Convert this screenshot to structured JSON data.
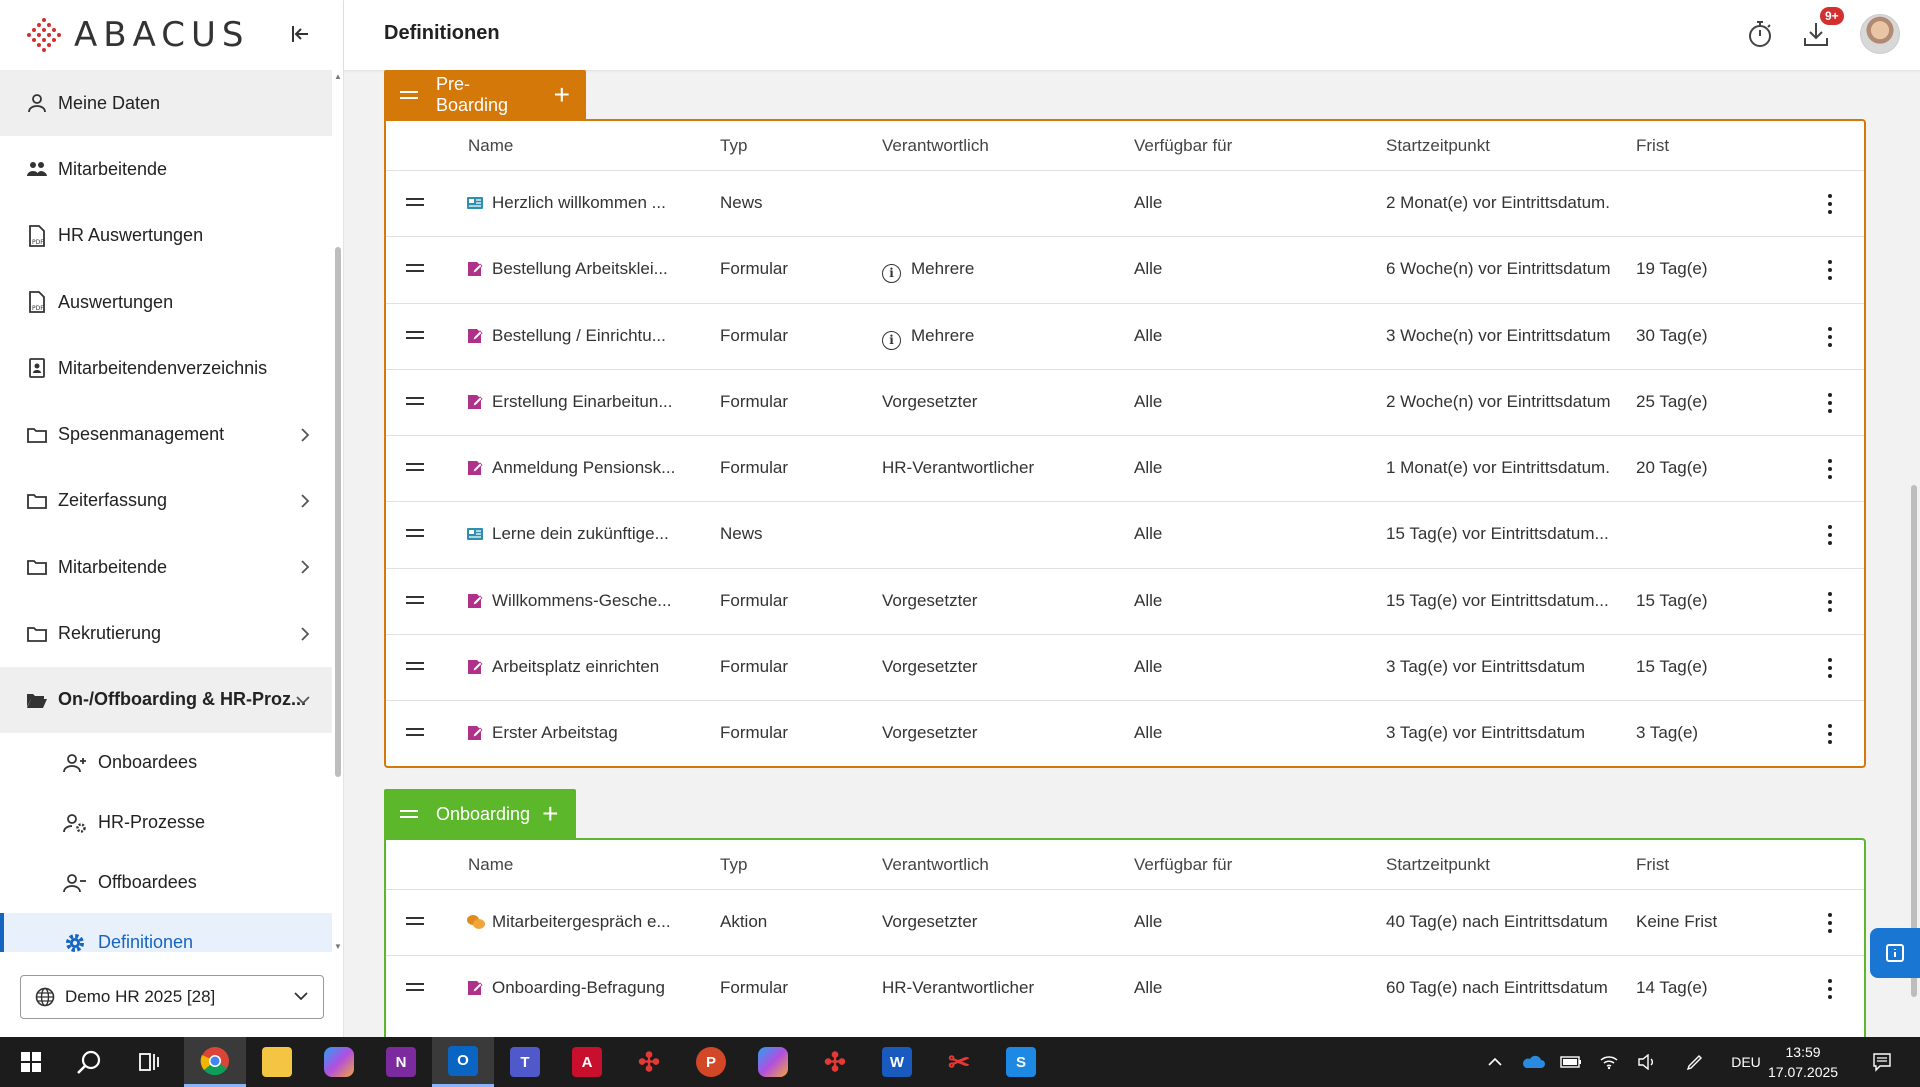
{
  "app": {
    "logo_text": "ABACUS"
  },
  "header": {
    "title": "Definitionen",
    "badge": "9+"
  },
  "sidebar": {
    "items": [
      {
        "label": "Meine Daten"
      },
      {
        "label": "Mitarbeitende"
      },
      {
        "label": "HR Auswertungen"
      },
      {
        "label": "Auswertungen"
      },
      {
        "label": "Mitarbeitendenverzeichnis"
      },
      {
        "label": "Spesenmanagement"
      },
      {
        "label": "Zeiterfassung"
      },
      {
        "label": "Mitarbeitende"
      },
      {
        "label": "Rekrutierung"
      },
      {
        "label": "On-/Offboarding & HR-Proz..."
      }
    ],
    "subitems": [
      {
        "label": "Onboardees"
      },
      {
        "label": "HR-Prozesse"
      },
      {
        "label": "Offboardees"
      },
      {
        "label": "Definitionen"
      }
    ],
    "tenant": "Demo HR 2025 [28]"
  },
  "columns": {
    "name": "Name",
    "typ": "Typ",
    "verantwortlich": "Verantwortlich",
    "verfuegbar": "Verfügbar für",
    "start": "Startzeitpunkt",
    "frist": "Frist"
  },
  "phases": [
    {
      "title": "Pre-Boarding",
      "color": "#d4780a",
      "rows": [
        {
          "icon": "news-icon",
          "name": "Herzlich willkommen ...",
          "typ": "News",
          "verantwortlich": "",
          "verfuegbar": "Alle",
          "start": "2 Monat(e) vor Eintrittsdatum.",
          "frist": ""
        },
        {
          "icon": "form-icon",
          "name": "Bestellung Arbeitsklei...",
          "typ": "Formular",
          "verantwortlich": "Mehrere",
          "verfuegbar": "Alle",
          "start": "6 Woche(n) vor Eintrittsdatum",
          "frist": "19 Tag(e)"
        },
        {
          "icon": "form-icon",
          "name": "Bestellung / Einrichtu...",
          "typ": "Formular",
          "verantwortlich": "Mehrere",
          "verfuegbar": "Alle",
          "start": "3 Woche(n) vor Eintrittsdatum",
          "frist": "30 Tag(e)"
        },
        {
          "icon": "form-icon",
          "name": "Erstellung Einarbeitun...",
          "typ": "Formular",
          "verantwortlich": "Vorgesetzter",
          "verfuegbar": "Alle",
          "start": "2 Woche(n) vor Eintrittsdatum",
          "frist": "25 Tag(e)"
        },
        {
          "icon": "form-icon",
          "name": "Anmeldung Pensionsk...",
          "typ": "Formular",
          "verantwortlich": "HR-Verantwortlicher",
          "verfuegbar": "Alle",
          "start": "1 Monat(e) vor Eintrittsdatum.",
          "frist": "20 Tag(e)"
        },
        {
          "icon": "news-icon",
          "name": "Lerne dein zukünftige...",
          "typ": "News",
          "verantwortlich": "",
          "verfuegbar": "Alle",
          "start": "15 Tag(e) vor Eintrittsdatum...",
          "frist": ""
        },
        {
          "icon": "form-icon",
          "name": "Willkommens-Gesche...",
          "typ": "Formular",
          "verantwortlich": "Vorgesetzter",
          "verfuegbar": "Alle",
          "start": "15 Tag(e) vor Eintrittsdatum...",
          "frist": "15 Tag(e)"
        },
        {
          "icon": "form-icon",
          "name": "Arbeitsplatz einrichten",
          "typ": "Formular",
          "verantwortlich": "Vorgesetzter",
          "verfuegbar": "Alle",
          "start": "3 Tag(e) vor Eintrittsdatum",
          "frist": "15 Tag(e)"
        },
        {
          "icon": "form-icon",
          "name": "Erster Arbeitstag",
          "typ": "Formular",
          "verantwortlich": "Vorgesetzter",
          "verfuegbar": "Alle",
          "start": "3 Tag(e) vor Eintrittsdatum",
          "frist": "3 Tag(e)"
        }
      ]
    },
    {
      "title": "Onboarding",
      "color": "#5cb82a",
      "rows": [
        {
          "icon": "chat-icon",
          "name": "Mitarbeitergespräch e...",
          "typ": "Aktion",
          "verantwortlich": "Vorgesetzter",
          "verfuegbar": "Alle",
          "start": "40 Tag(e) nach Eintrittsdatum",
          "frist": "Keine Frist"
        },
        {
          "icon": "form-icon",
          "name": "Onboarding-Befragung",
          "typ": "Formular",
          "verantwortlich": "HR-Verantwortlicher",
          "verfuegbar": "Alle",
          "start": "60 Tag(e) nach Eintrittsdatum",
          "frist": "14 Tag(e)"
        }
      ]
    }
  ],
  "taskbar": {
    "lang": "DEU",
    "time": "13:59",
    "date": "17.07.2025"
  }
}
